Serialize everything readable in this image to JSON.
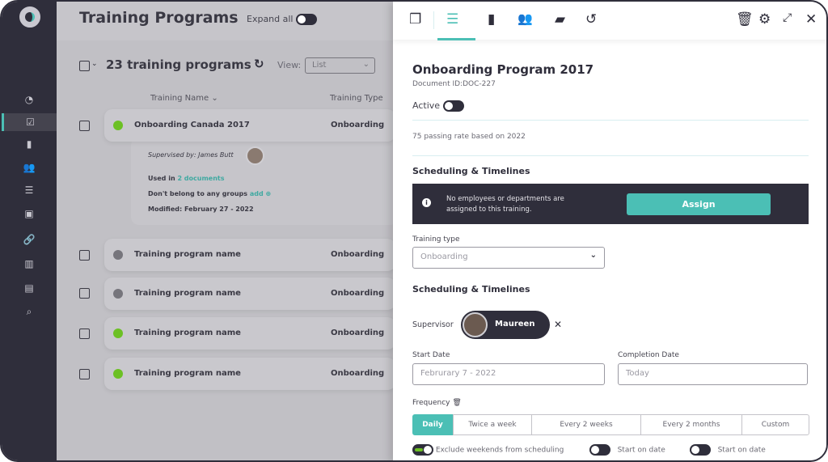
{
  "header": {
    "title": "Training Programs",
    "expand_all": "Expand all"
  },
  "sidebar": {
    "items": [
      {
        "icon": "dashboard-icon"
      },
      {
        "icon": "checklist-icon",
        "active": true
      },
      {
        "icon": "document-icon"
      },
      {
        "icon": "users-icon"
      },
      {
        "icon": "list-icon"
      },
      {
        "icon": "media-icon"
      },
      {
        "icon": "link-icon"
      },
      {
        "icon": "barcode-icon"
      },
      {
        "icon": "table-icon"
      },
      {
        "icon": "search-icon"
      }
    ]
  },
  "list": {
    "count_label": "23 training programs",
    "view_label": "View:",
    "view_value": "List",
    "col_name": "Training Name",
    "col_type": "Training Type",
    "expanded": {
      "name": "Onboarding Canada 2017",
      "type": "Onboarding",
      "status_color": "#6cc024",
      "supervised": "Supervised by: James Butt",
      "used_in": "Used in",
      "used_link": "2 documents",
      "groups": "Don't belong to any groups",
      "groups_link": "add",
      "modified": "Modified: February 27 - 2022"
    },
    "rows": [
      {
        "name": "Training program name",
        "type": "Onboarding",
        "status_color": "#76757c"
      },
      {
        "name": "Training program name",
        "type": "Onboarding",
        "status_color": "#76757c"
      },
      {
        "name": "Training program name",
        "type": "Onboarding",
        "status_color": "#6cc024"
      },
      {
        "name": "Training program name",
        "type": "Onboarding",
        "status_color": "#6cc024"
      }
    ]
  },
  "panel": {
    "title": "Onboarding Program 2017",
    "doc_id": "Document ID:DOC-227",
    "active_label": "Active",
    "passing": "75 passing rate based on 2022",
    "section1": "Scheduling & Timelines",
    "notice": "No employees or departments are assigned to this training.",
    "assign": "Assign",
    "training_type_label": "Training type",
    "training_type_value": "Onboarding",
    "section2": "Scheduling & Timelines",
    "supervisor_label": "Supervisor",
    "supervisor_name": "Maureen",
    "start_label": "Start Date",
    "start_value": "Februrary 7 - 2022",
    "completion_label": "Completion Date",
    "completion_value": "Today",
    "frequency_label": "Frequency",
    "frequency_options": [
      "Daily",
      "Twice a week",
      "Every 2 weeks",
      "Every 2 months",
      "Custom"
    ],
    "frequency_selected": "Daily",
    "exclude_weekends": "Exclude weekends from scheduling",
    "start_on_date_1": "Start on date",
    "start_on_date_2": "Start on date"
  },
  "colors": {
    "accent": "#4bbfb5",
    "dark": "#2f2e3b",
    "active_green": "#6cc024"
  }
}
